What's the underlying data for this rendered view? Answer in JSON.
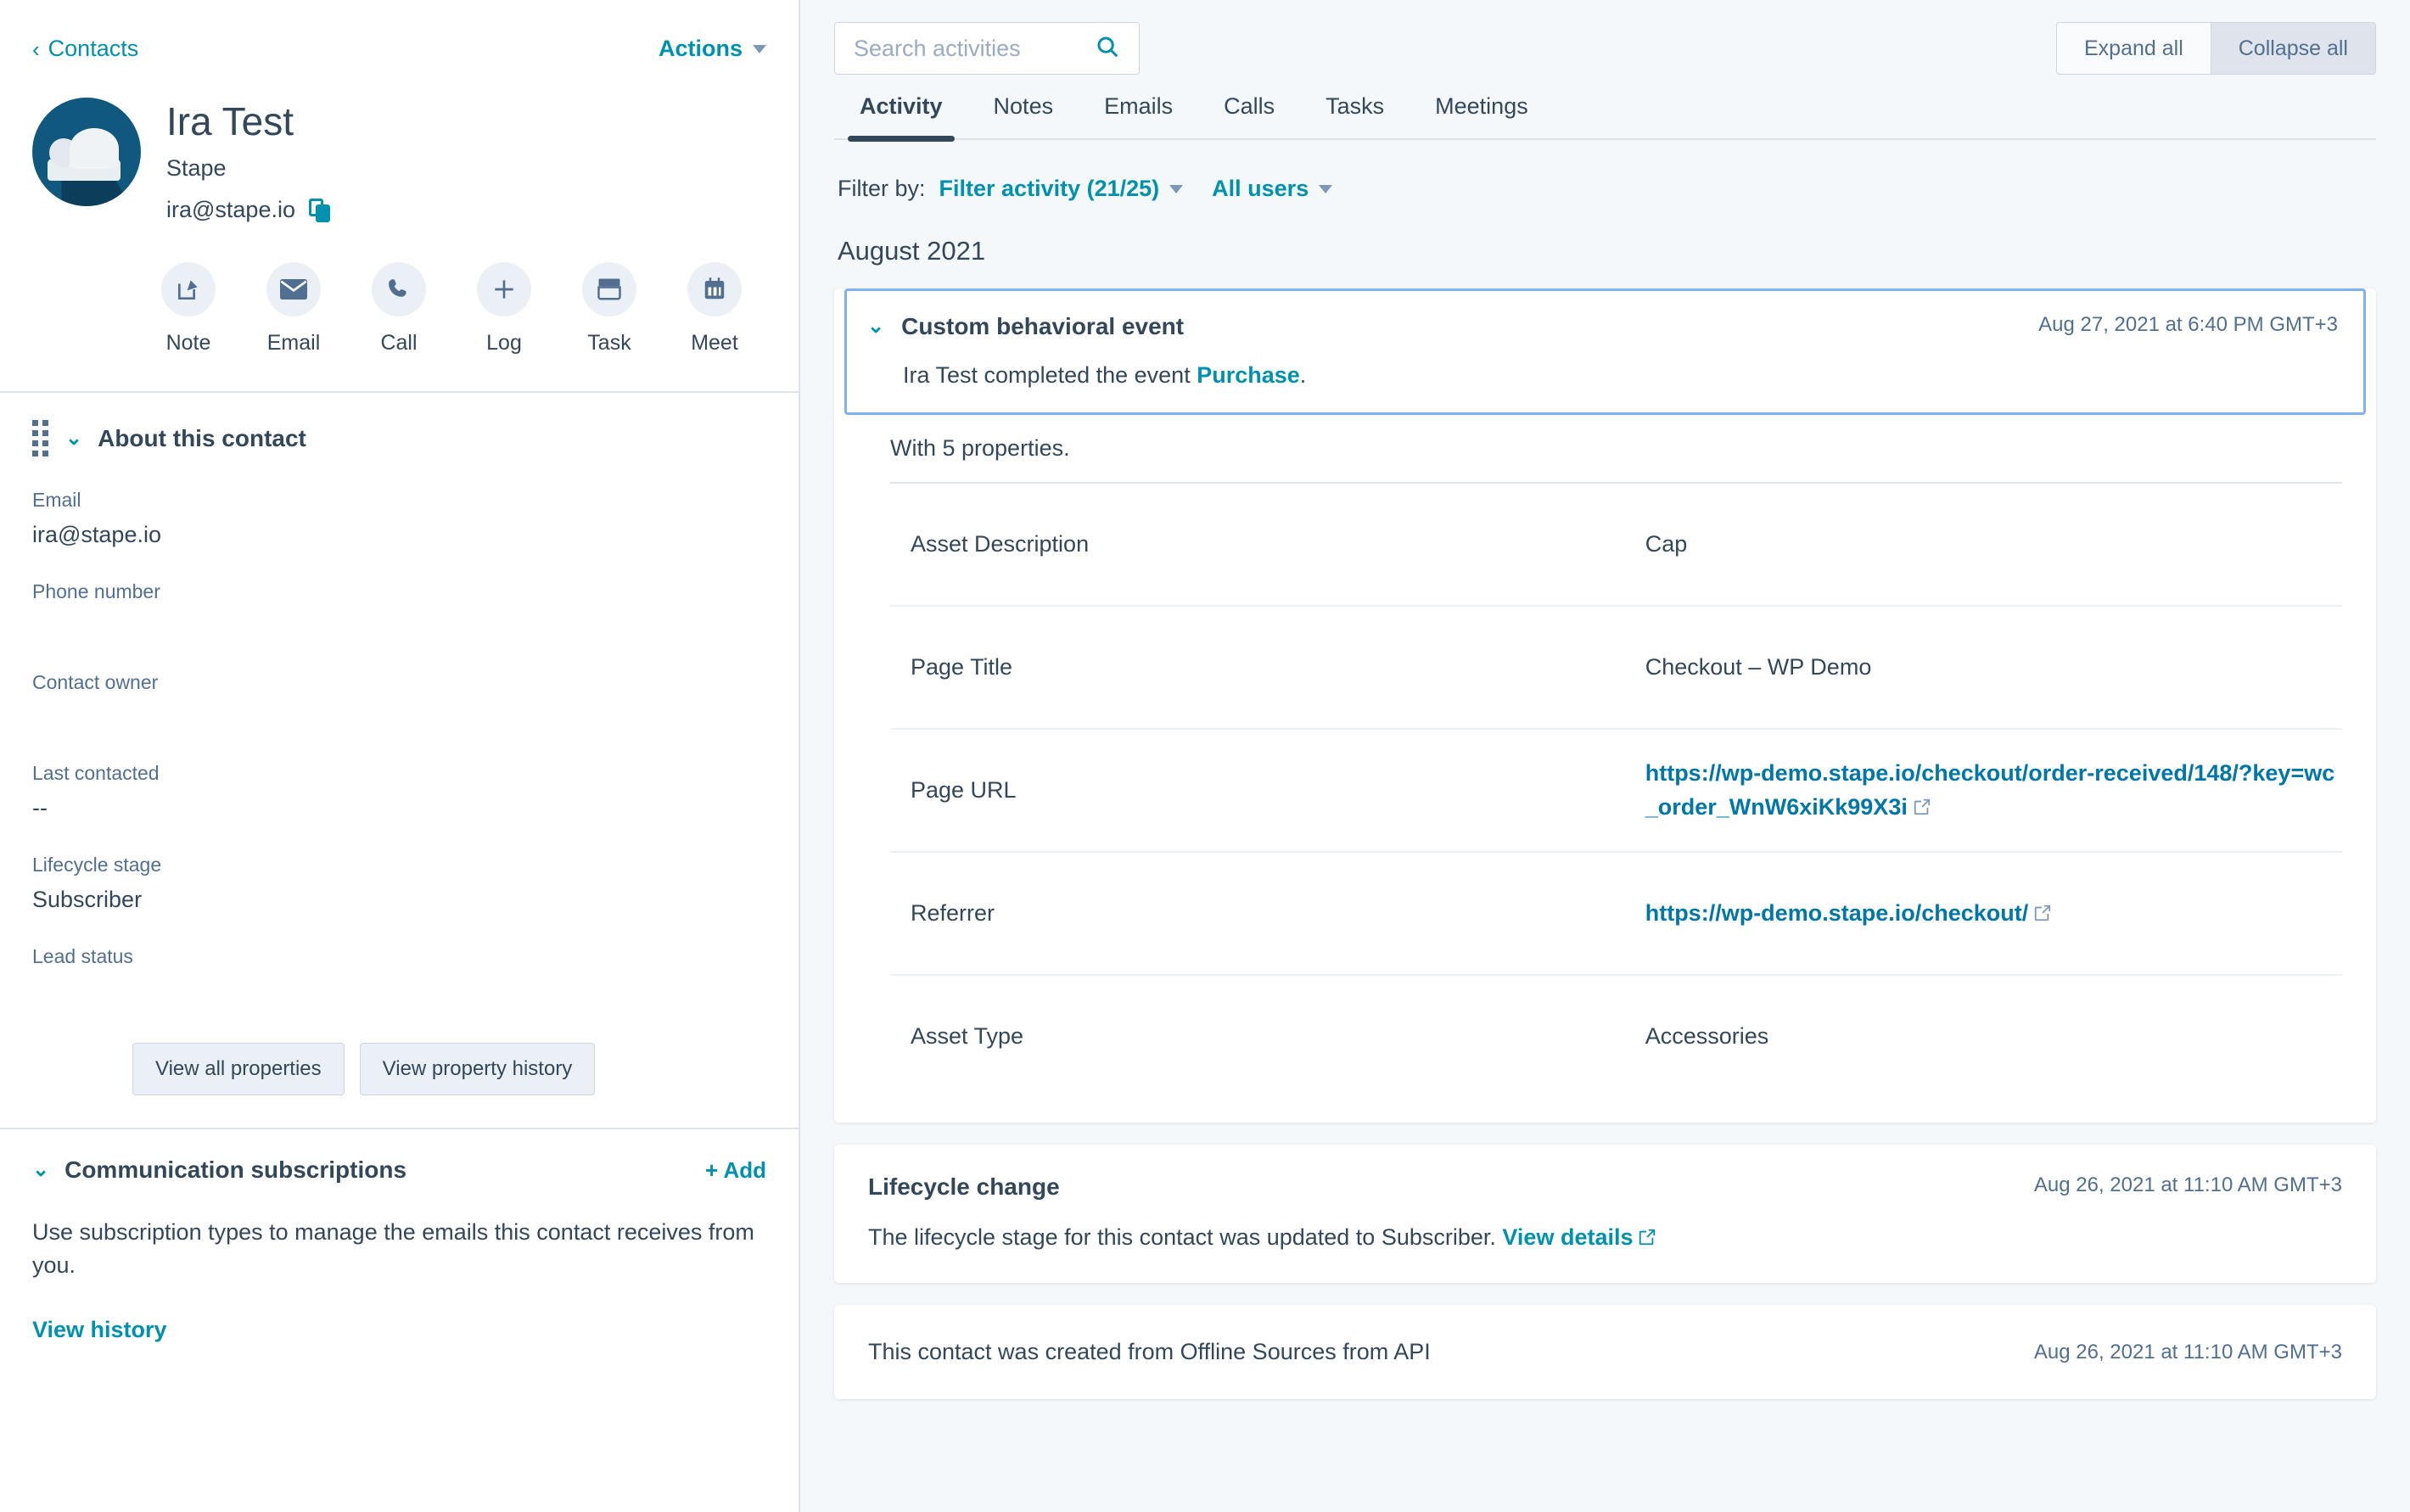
{
  "sidebar": {
    "back_label": "Contacts",
    "actions_label": "Actions",
    "contact": {
      "name": "Ira Test",
      "company": "Stape",
      "email": "ira@stape.io",
      "copy_icon": "copy-icon",
      "avatar_icon": "cloud-avatar"
    },
    "quick_actions": [
      {
        "label": "Note",
        "icon": "note-pencil-icon"
      },
      {
        "label": "Email",
        "icon": "envelope-icon"
      },
      {
        "label": "Call",
        "icon": "phone-icon"
      },
      {
        "label": "Log",
        "icon": "plus-icon"
      },
      {
        "label": "Task",
        "icon": "task-icon"
      },
      {
        "label": "Meet",
        "icon": "calendar-icon"
      }
    ],
    "about": {
      "title": "About this contact",
      "properties": [
        {
          "label": "Email",
          "value": "ira@stape.io"
        },
        {
          "label": "Phone number",
          "value": ""
        },
        {
          "label": "Contact owner",
          "value": ""
        },
        {
          "label": "Last contacted",
          "value": "--"
        },
        {
          "label": "Lifecycle stage",
          "value": "Subscriber"
        },
        {
          "label": "Lead status",
          "value": ""
        }
      ],
      "view_all_properties": "View all properties",
      "view_property_history": "View property history"
    },
    "subscriptions": {
      "title": "Communication subscriptions",
      "add_label": "+ Add",
      "body": "Use subscription types to manage the emails this contact receives from you.",
      "view_history": "View history"
    }
  },
  "main": {
    "search": {
      "placeholder": "Search activities",
      "value": "",
      "icon": "search-icon"
    },
    "expand_all": "Expand all",
    "collapse_all": "Collapse all",
    "tabs": [
      {
        "label": "Activity",
        "active": true
      },
      {
        "label": "Notes",
        "active": false
      },
      {
        "label": "Emails",
        "active": false
      },
      {
        "label": "Calls",
        "active": false
      },
      {
        "label": "Tasks",
        "active": false
      },
      {
        "label": "Meetings",
        "active": false
      }
    ],
    "filter": {
      "label": "Filter by:",
      "activity_filter": "Filter activity (21/25)",
      "users_filter": "All users"
    },
    "month_header": "August 2021",
    "event_card": {
      "title": "Custom behavioral event",
      "date": "Aug 27, 2021 at 6:40 PM GMT+3",
      "description_prefix": "Ira Test completed the event ",
      "description_link": "Purchase",
      "description_suffix": ".",
      "properties_note": "With 5 properties.",
      "properties": [
        {
          "key": "Asset Description",
          "value": "Cap",
          "is_link": false
        },
        {
          "key": "Page Title",
          "value": "Checkout – WP Demo",
          "is_link": false
        },
        {
          "key": "Page URL",
          "value": "https://wp-demo.stape.io/checkout/order-received/148/?key=wc_order_WnW6xiKk99X3i",
          "is_link": true
        },
        {
          "key": "Referrer",
          "value": "https://wp-demo.stape.io/checkout/",
          "is_link": true
        },
        {
          "key": "Asset Type",
          "value": "Accessories",
          "is_link": false
        }
      ]
    },
    "lifecycle_card": {
      "title": "Lifecycle change",
      "date": "Aug 26, 2021 at 11:10 AM GMT+3",
      "body_prefix": "The lifecycle stage for this contact was updated to Subscriber. ",
      "body_link": "View details"
    },
    "created_card": {
      "text": "This contact was created from Offline Sources from API",
      "date": "Aug 26, 2021 at 11:10 AM GMT+3"
    }
  },
  "colors": {
    "accent_teal": "#0091ae",
    "text_dark": "#33475b",
    "text_muted": "#516f90",
    "highlight_border": "#7fb2f0",
    "link_blue": "#0077a8",
    "page_bg": "#f5f8fa"
  }
}
